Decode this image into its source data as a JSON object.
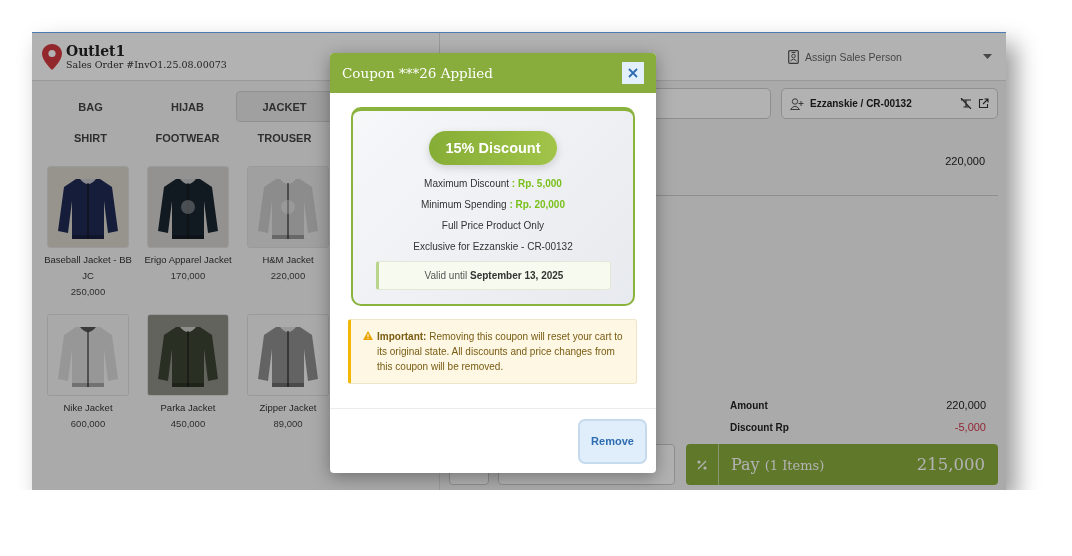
{
  "header": {
    "outlet": "Outlet1",
    "order": "Sales Order #InvO1.25.08.00073",
    "sales_person": {
      "placeholder": "Assign Sales Person"
    }
  },
  "categories": [
    {
      "label": "BAG",
      "selected": false
    },
    {
      "label": "HIJAB",
      "selected": false
    },
    {
      "label": "JACKET",
      "selected": true
    },
    {
      "label": "SHIRT",
      "selected": false
    },
    {
      "label": "FOOTWEAR",
      "selected": false
    },
    {
      "label": "TROUSER",
      "selected": false
    }
  ],
  "products": [
    {
      "name": "Baseball Jacket - BBJC",
      "price": "250,000"
    },
    {
      "name": "Erigo Apparel Jacket",
      "price": "170,000"
    },
    {
      "name": "H&M Jacket",
      "price": "220,000"
    },
    {
      "name": "Nike Jacket",
      "price": "600,000"
    },
    {
      "name": "Parka Jacket",
      "price": "450,000"
    },
    {
      "name": "Zipper Jacket",
      "price": "89,000"
    }
  ],
  "customer": {
    "value": "Ezzanskie / CR-00132"
  },
  "cart": {
    "line_total": "220,000"
  },
  "totals": [
    {
      "label": "Amount",
      "value": "220,000",
      "kind": "plain"
    },
    {
      "label": "Discount Rp",
      "value": "-5,000",
      "kind": "negative"
    }
  ],
  "pay": {
    "label": "Pay",
    "count": "(1 Items)",
    "total": "215,000"
  },
  "modal": {
    "title": "Coupon ***26 Applied",
    "badge": "15% Discount",
    "terms": [
      {
        "label": "Maximum Discount",
        "value": ": Rp. 5,000"
      },
      {
        "label": "Minimum Spending",
        "value": ": Rp. 20,000"
      },
      {
        "label": "Full Price Product Only"
      },
      {
        "label": "Exclusive for Ezzanskie - CR-00132"
      }
    ],
    "validity": "Valid until **September 13, 2025**",
    "warning": "**Important:** Removing this coupon will reset your cart to its original state. All discounts and price changes from this coupon will be removed.",
    "button": "Remove"
  }
}
